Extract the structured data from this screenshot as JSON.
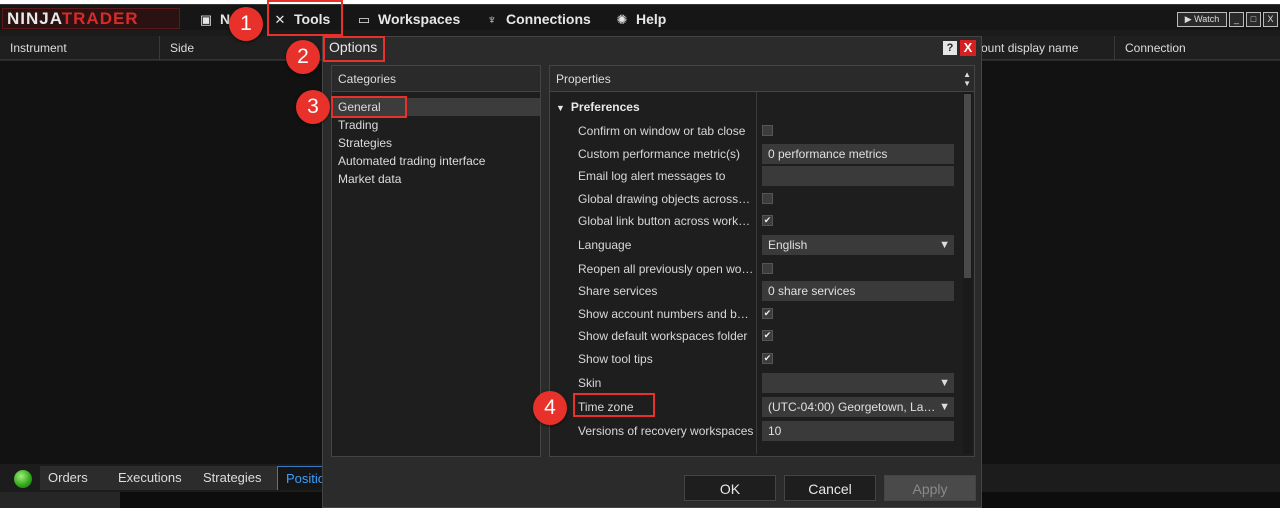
{
  "app": {
    "logo_left": "NINJA",
    "logo_right": "TRADER",
    "menu": [
      {
        "label": "N",
        "icon": "window-icon"
      },
      {
        "label": "Tools",
        "icon": "tools-icon"
      },
      {
        "label": "Workspaces",
        "icon": "workspaces-icon"
      },
      {
        "label": "Connections",
        "icon": "plug-icon"
      },
      {
        "label": "Help",
        "icon": "lifebuoy-icon"
      }
    ],
    "window_buttons": [
      "Watch",
      "_",
      "□",
      "X"
    ]
  },
  "grid": {
    "columns": [
      "Instrument",
      "Side",
      "ount display name",
      "Connection"
    ]
  },
  "bottom_tabs": [
    "Orders",
    "Executions",
    "Strategies",
    "Positio"
  ],
  "dialog": {
    "title": "Options",
    "help": "?",
    "close": "X",
    "categories_header": "Categories",
    "categories": [
      "General",
      "Trading",
      "Strategies",
      "Automated trading interface",
      "Market data"
    ],
    "selected_category": "General",
    "properties_header": "Properties",
    "section": "Preferences",
    "properties": [
      {
        "label": "Confirm on window or tab close",
        "type": "checkbox",
        "checked": false
      },
      {
        "label": "Custom performance metric(s)",
        "type": "text",
        "value": "0 performance metrics"
      },
      {
        "label": "Email log alert messages to",
        "type": "text",
        "value": ""
      },
      {
        "label": "Global drawing objects across…",
        "type": "checkbox",
        "checked": false
      },
      {
        "label": "Global link button across work…",
        "type": "checkbox",
        "checked": true
      },
      {
        "label": "Language",
        "type": "select",
        "value": "English"
      },
      {
        "label": "Reopen all previously open wo…",
        "type": "checkbox",
        "checked": false
      },
      {
        "label": "Share services",
        "type": "text",
        "value": "0 share services"
      },
      {
        "label": "Show account numbers and b…",
        "type": "checkbox",
        "checked": true
      },
      {
        "label": "Show default workspaces folder",
        "type": "checkbox",
        "checked": true
      },
      {
        "label": "Show tool tips",
        "type": "checkbox",
        "checked": true
      },
      {
        "label": "Skin",
        "type": "select",
        "value": ""
      },
      {
        "label": "Time zone",
        "type": "select",
        "value": "(UTC-04:00) Georgetown, La…"
      },
      {
        "label": "Versions of recovery workspaces",
        "type": "text",
        "value": "10"
      }
    ],
    "buttons": {
      "ok": "OK",
      "cancel": "Cancel",
      "apply": "Apply"
    }
  },
  "annotations": [
    "1",
    "2",
    "3",
    "4"
  ],
  "colors": {
    "annotation": "#e8312a",
    "accent_tab": "#3aa0ff",
    "close_button": "#d42020"
  }
}
